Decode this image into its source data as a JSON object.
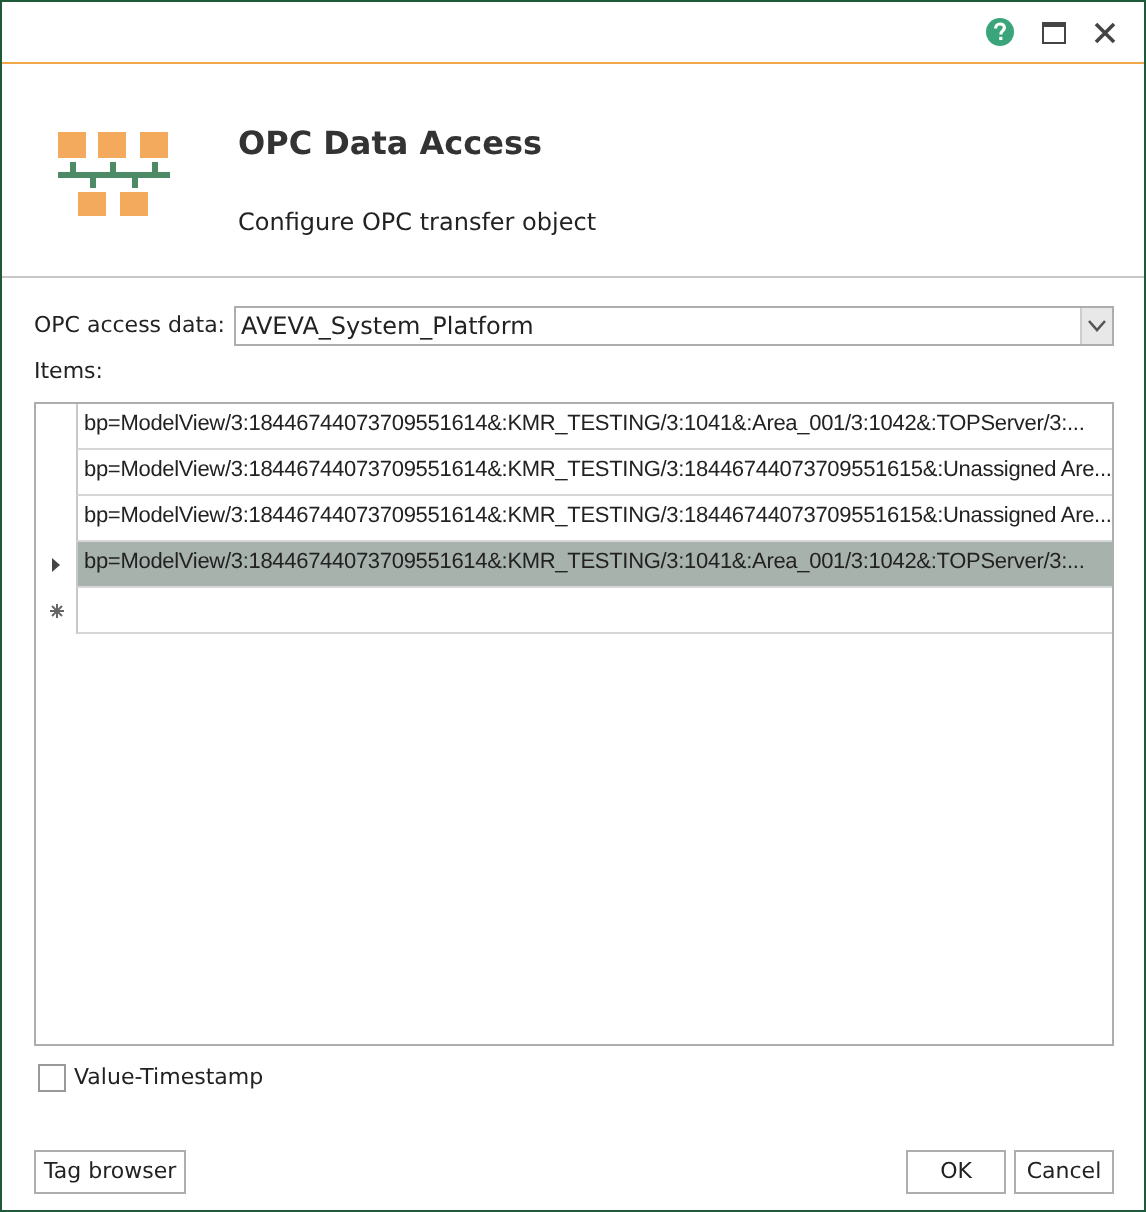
{
  "header": {
    "title": "OPC Data Access",
    "subtitle": "Configure OPC transfer object"
  },
  "access_data": {
    "label": "OPC access data:",
    "value": "AVEVA_System_Platform"
  },
  "items": {
    "label": "Items:",
    "rows": [
      {
        "text": "bp=ModelView/3:18446744073709551614&:KMR_TESTING/3:1041&:Area_001/3:1042&:TOPServer/3:...",
        "selected": false
      },
      {
        "text": "bp=ModelView/3:18446744073709551614&:KMR_TESTING/3:18446744073709551615&:Unassigned Are...",
        "selected": false
      },
      {
        "text": "bp=ModelView/3:18446744073709551614&:KMR_TESTING/3:18446744073709551615&:Unassigned Are...",
        "selected": false
      },
      {
        "text": "bp=ModelView/3:18446744073709551614&:KMR_TESTING/3:1041&:Area_001/3:1042&:TOPServer/3:...",
        "selected": true
      }
    ]
  },
  "value_timestamp": {
    "label": "Value-Timestamp",
    "checked": false
  },
  "buttons": {
    "left": [
      "Tag browser"
    ],
    "right": [
      "OK",
      "Cancel"
    ]
  }
}
